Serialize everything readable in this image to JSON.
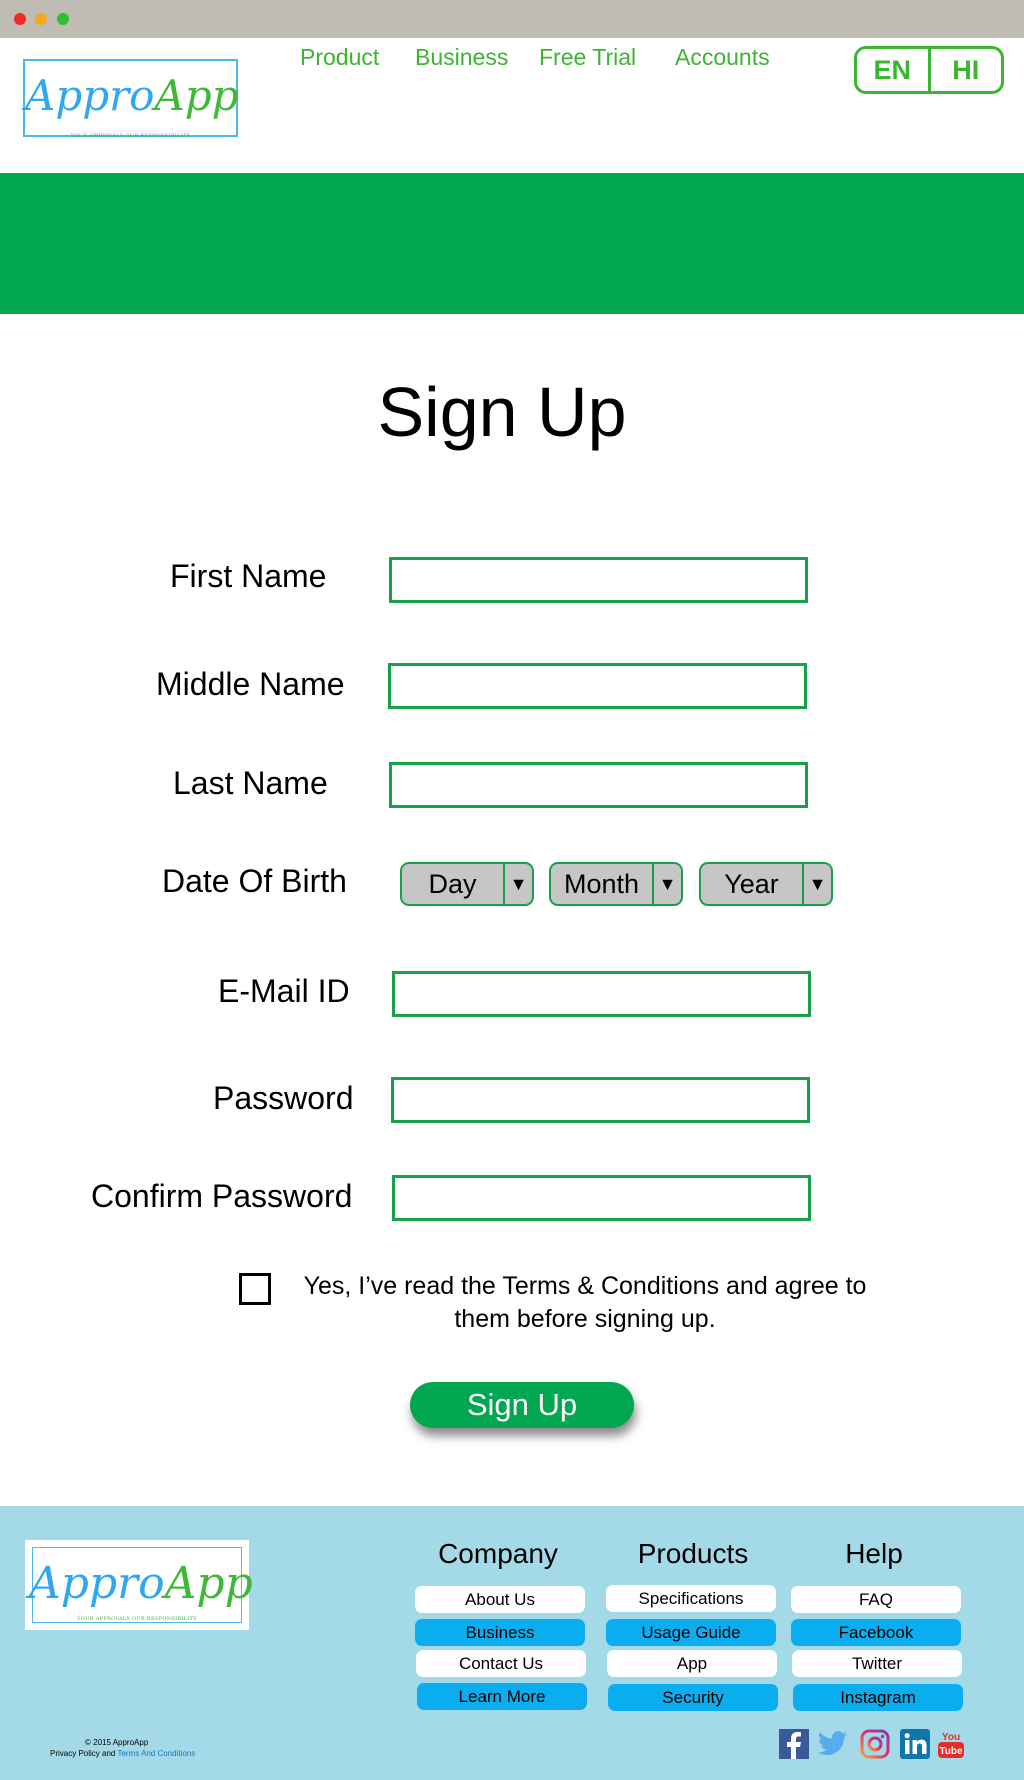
{
  "nav": {
    "logo": {
      "brand_part1": "Appro",
      "brand_part2": "App",
      "tagline": "YOUR APPROVALS OUR RESPONSIBILITY"
    },
    "links": [
      "Product",
      "Business",
      "Free Trial",
      "Accounts"
    ],
    "lang": [
      "EN",
      "HI"
    ]
  },
  "form": {
    "title": "Sign Up",
    "fields": {
      "first_name": {
        "label": "First Name",
        "value": ""
      },
      "middle_name": {
        "label": "Middle Name",
        "value": ""
      },
      "last_name": {
        "label": "Last Name",
        "value": ""
      },
      "dob": {
        "label": "Date Of Birth",
        "day": "Day",
        "month": "Month",
        "year": "Year"
      },
      "email": {
        "label": "E-Mail ID",
        "value": ""
      },
      "password": {
        "label": "Password",
        "value": ""
      },
      "confirm_password": {
        "label": "Confirm Password",
        "value": ""
      }
    },
    "terms": "Yes, I’ve read the Terms & Conditions and agree to them before signing up.",
    "terms_checked": false,
    "submit": "Sign Up"
  },
  "footer": {
    "logo": {
      "brand_part1": "Appro",
      "brand_part2": "App",
      "tagline": "YOUR APPROVALS OUR RESPONSIBILITY"
    },
    "columns": [
      {
        "title": "Company",
        "items": [
          "About Us",
          "Business",
          "Contact Us",
          "Learn More"
        ]
      },
      {
        "title": "Products",
        "items": [
          "Specifications",
          "Usage Guide",
          "App",
          "Security"
        ]
      },
      {
        "title": "Help",
        "items": [
          "FAQ",
          "Facebook",
          "Twitter",
          "Instagram"
        ]
      }
    ],
    "copyright_line1": "© 2015 ApproApp",
    "copyright_line2_prefix": "Privacy Policy and ",
    "copyright_line2_link": "Terms And Conditions",
    "social": [
      "facebook-icon",
      "twitter-icon",
      "instagram-icon",
      "linkedin-icon",
      "youtube-icon"
    ]
  },
  "colors": {
    "green": "#00a650",
    "nav_green": "#3cb531",
    "footer_bg": "#a4d9e8",
    "footer_blue": "#0aaeef",
    "logo_blue": "#2fa8f0"
  }
}
